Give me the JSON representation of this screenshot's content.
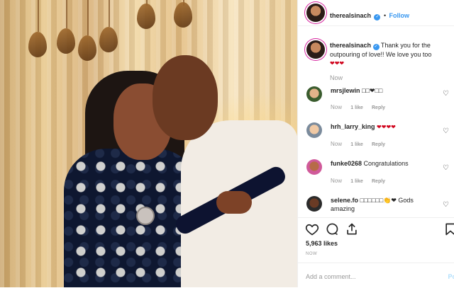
{
  "post": {
    "username": "therealsinach",
    "follow_label": "Follow",
    "caption": "Thank you for the outpouring of love!! We love you too",
    "caption_hearts": "❤❤❤",
    "caption_time": "Now",
    "likes": "5,963 likes",
    "posted": "NOW",
    "add_comment_placeholder": "Add a comment...",
    "post_label": "Post"
  },
  "comments": [
    {
      "username": "mrsjlewin",
      "text": "□□❤□□",
      "time": "Now",
      "likes": "1 like",
      "reply": "Reply"
    },
    {
      "username": "hrh_larry_king",
      "text": "❤❤❤❤",
      "time": "Now",
      "likes": "1 like",
      "reply": "Reply"
    },
    {
      "username": "funke0268",
      "text": "Congratulations",
      "time": "Now",
      "likes": "1 like",
      "reply": "Reply"
    },
    {
      "username": "selene.fo",
      "text": "□□□□□□👏❤ Gods amazing",
      "time": "",
      "likes": "",
      "reply": ""
    }
  ],
  "icons": {
    "verified": "verified-badge-icon",
    "heart": "heart-icon",
    "comment": "comment-icon",
    "share": "share-icon",
    "save": "bookmark-icon"
  },
  "colors": {
    "link_blue": "#3897f0",
    "heart_red": "#d0021b",
    "muted": "#999999",
    "post_disabled": "#b2dffc"
  }
}
